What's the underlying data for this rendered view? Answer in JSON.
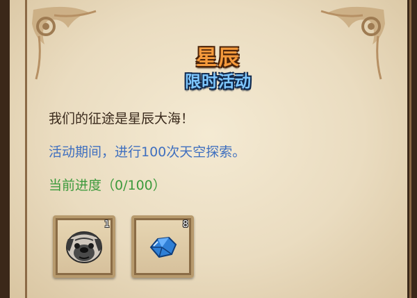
{
  "event": {
    "title": "星辰",
    "subtitle": "限时活动",
    "slogan": "我们的征途是星辰大海！",
    "description": "活动期间，进行100次天空探索。",
    "progress_text": "当前进度（0/100）",
    "progress_current": 0,
    "progress_target": 100
  },
  "rewards": [
    {
      "icon": "pug-head-icon",
      "count": "1"
    },
    {
      "icon": "blue-crystal-icon",
      "count": "8"
    }
  ],
  "colors": {
    "title": "#f59a3c",
    "subtitle": "#7ec7ff",
    "description": "#3f6fbf",
    "progress": "#3c9a3c"
  }
}
